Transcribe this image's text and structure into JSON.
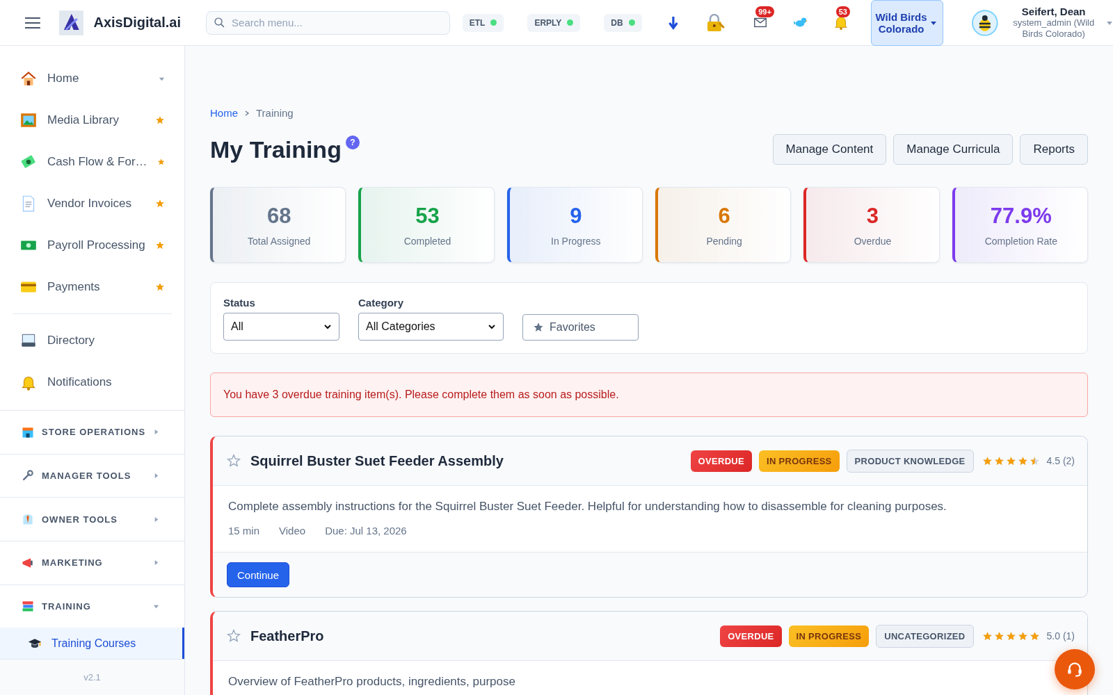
{
  "header": {
    "brand": "AxisDigital.ai",
    "search": {
      "placeholder": "Search menu..."
    },
    "statuses": [
      {
        "label": "ETL",
        "color": "#4ade80"
      },
      {
        "label": "ERPLY",
        "color": "#4ade80"
      },
      {
        "label": "DB",
        "color": "#4ade80"
      }
    ],
    "notifications": [
      {
        "count": "99+"
      },
      {
        "count": "53"
      }
    ],
    "store": {
      "label": "Wild Birds Colorado"
    },
    "user": {
      "name": "Seifert, Dean",
      "role": "system_admin (Wild Birds Colorado)"
    }
  },
  "sidebar": {
    "items": [
      {
        "label": "Home",
        "kind": "dropdown"
      },
      {
        "label": "Media Library",
        "kind": "link",
        "starred": true
      },
      {
        "label": "Cash Flow & For…",
        "kind": "link",
        "starred": true
      },
      {
        "label": "Vendor Invoices",
        "kind": "link",
        "starred": true
      },
      {
        "label": "Payroll Processing",
        "kind": "link",
        "starred": true
      },
      {
        "label": "Payments",
        "kind": "link",
        "starred": true
      },
      {
        "label": "Directory",
        "kind": "link",
        "starred": false
      },
      {
        "label": "Notifications",
        "kind": "link",
        "starred": false
      }
    ],
    "sections": [
      {
        "label": "STORE OPERATIONS",
        "expanded": false
      },
      {
        "label": "MANAGER TOOLS",
        "expanded": false
      },
      {
        "label": "OWNER TOOLS",
        "expanded": false
      },
      {
        "label": "MARKETING",
        "expanded": false
      },
      {
        "label": "TRAINING",
        "expanded": true,
        "children": [
          {
            "label": "Training Courses",
            "selected": true
          }
        ]
      }
    ],
    "version": "v2.1"
  },
  "breadcrumb": [
    "Home",
    "Training"
  ],
  "title": "My Training",
  "help": "?",
  "actions": [
    "Manage Content",
    "Manage Curricula",
    "Reports"
  ],
  "stats": [
    {
      "value": "68",
      "label": "Total Assigned",
      "color": "#64748b"
    },
    {
      "value": "53",
      "label": "Completed",
      "color": "#16a34a"
    },
    {
      "value": "9",
      "label": "In Progress",
      "color": "#2563eb"
    },
    {
      "value": "6",
      "label": "Pending",
      "color": "#d97706"
    },
    {
      "value": "3",
      "label": "Overdue",
      "color": "#dc2626"
    },
    {
      "value": "77.9%",
      "label": "Completion Rate",
      "color": "#7c3aed"
    }
  ],
  "filters": {
    "status": {
      "label": "Status",
      "value": "All"
    },
    "category": {
      "label": "Category",
      "value": "All Categories"
    },
    "favorites": {
      "label": "Favorites",
      "selected": false
    }
  },
  "alert": "You have 3 overdue training item(s). Please complete them as soon as possible.",
  "courses": [
    {
      "title": "Squirrel Buster Suet Feeder Assembly",
      "favorite": false,
      "badges": [
        {
          "label": "OVERDUE",
          "kind": "overdue"
        },
        {
          "label": "IN PROGRESS",
          "kind": "progress"
        },
        {
          "label": "PRODUCT KNOWLEDGE",
          "kind": "category"
        }
      ],
      "stars": 4.5,
      "rating": "4.5 (2)",
      "description": "Complete assembly instructions for the Squirrel Buster Suet Feeder. Helpful for understanding how to disassemble for cleaning purposes.",
      "meta": [
        "15 min",
        "Video",
        "Due: Jul 13, 2026"
      ],
      "action": "Continue"
    },
    {
      "title": "FeatherPro",
      "favorite": false,
      "badges": [
        {
          "label": "OVERDUE",
          "kind": "overdue"
        },
        {
          "label": "IN PROGRESS",
          "kind": "progress"
        },
        {
          "label": "UNCATEGORIZED",
          "kind": "category"
        }
      ],
      "stars": 5,
      "rating": "5.0 (1)",
      "description": "Overview of FeatherPro products, ingredients, purpose"
    }
  ]
}
